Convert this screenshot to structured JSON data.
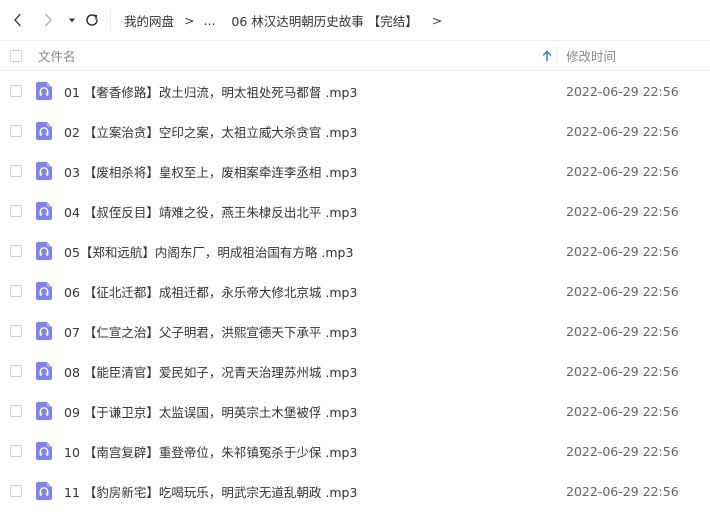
{
  "breadcrumb": {
    "root": "我的网盘",
    "separator": ">",
    "ellipsis": "...",
    "current": "06 林汉达明朝历史故事 【完结】"
  },
  "nav_icons": {
    "back": "chevron-left-icon",
    "forward": "chevron-right-icon",
    "history": "caret-down-icon",
    "refresh": "refresh-icon"
  },
  "columns": {
    "name": "文件名",
    "modified": "修改时间",
    "sort_icon": "sort-ascending-arrow-icon"
  },
  "colors": {
    "accent": "#1e7df0",
    "file_icon": "#7b84f2"
  },
  "files": [
    {
      "name": "01 【奢香修路】改土归流，明太祖处死马都督 .mp3",
      "modified": "2022-06-29 22:56",
      "icon": "audio-file-icon"
    },
    {
      "name": "02 【立案治贪】空印之案，太祖立威大杀贪官 .mp3",
      "modified": "2022-06-29 22:56",
      "icon": "audio-file-icon"
    },
    {
      "name": "03 【废相杀将】皇权至上，废相案牵连李丞相 .mp3",
      "modified": "2022-06-29 22:56",
      "icon": "audio-file-icon"
    },
    {
      "name": "04 【叔侄反目】靖难之役，燕王朱棣反出北平 .mp3",
      "modified": "2022-06-29 22:56",
      "icon": "audio-file-icon"
    },
    {
      "name": "05【郑和远航】内阁东厂，明成祖治国有方略 .mp3",
      "modified": "2022-06-29 22:56",
      "icon": "audio-file-icon"
    },
    {
      "name": "06 【征北迁都】成祖迁都，永乐帝大修北京城 .mp3",
      "modified": "2022-06-29 22:56",
      "icon": "audio-file-icon"
    },
    {
      "name": "07 【仁宣之治】父子明君，洪熙宣德天下承平 .mp3",
      "modified": "2022-06-29 22:56",
      "icon": "audio-file-icon"
    },
    {
      "name": "08 【能臣清官】爱民如子，况青天治理苏州城 .mp3",
      "modified": "2022-06-29 22:56",
      "icon": "audio-file-icon"
    },
    {
      "name": "09 【于谦卫京】太监误国，明英宗土木堡被俘 .mp3",
      "modified": "2022-06-29 22:56",
      "icon": "audio-file-icon"
    },
    {
      "name": "10 【南宫复辟】重登帝位，朱祁镇冤杀于少保 .mp3",
      "modified": "2022-06-29 22:56",
      "icon": "audio-file-icon"
    },
    {
      "name": "11 【豹房新宅】吃喝玩乐，明武宗无道乱朝政 .mp3",
      "modified": "2022-06-29 22:56",
      "icon": "audio-file-icon"
    }
  ]
}
